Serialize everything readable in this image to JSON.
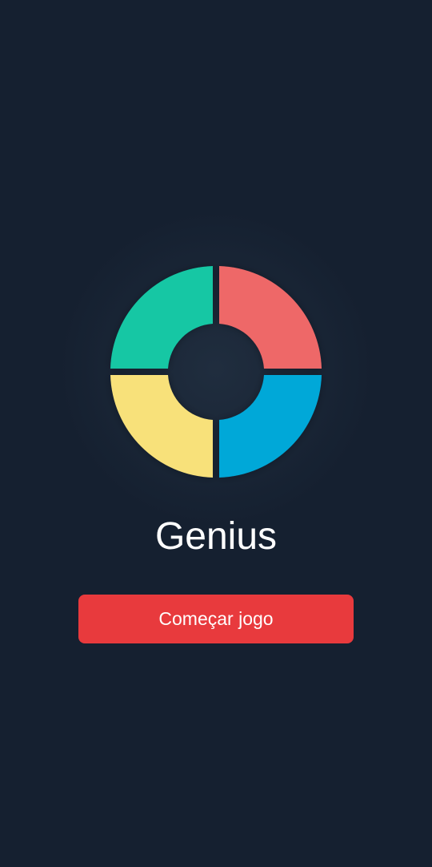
{
  "app": {
    "title": "Genius"
  },
  "actions": {
    "start_label": "Começar jogo"
  },
  "logo": {
    "quadrants": [
      {
        "name": "green",
        "color": "#12c7a4"
      },
      {
        "name": "red",
        "color": "#ee6768"
      },
      {
        "name": "yellow",
        "color": "#f8e17a"
      },
      {
        "name": "blue",
        "color": "#00a8d8"
      }
    ]
  },
  "colors": {
    "background": "#152030",
    "title_text": "#ffffff",
    "button_background": "#e83a3d",
    "button_text": "#ffffff"
  }
}
